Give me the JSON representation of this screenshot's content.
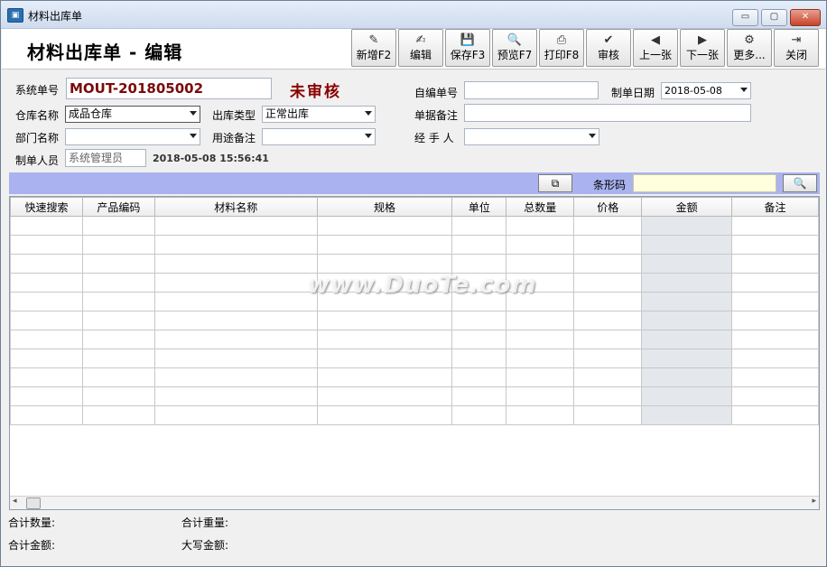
{
  "window": {
    "title": "材料出库单",
    "controls": {
      "minimize": "▭",
      "restore": "▢",
      "close": "✕"
    }
  },
  "header": {
    "title": "材料出库单 - 编辑"
  },
  "toolbar": [
    {
      "label": "新增F2",
      "icon": "new-icon",
      "glyph": "✎"
    },
    {
      "label": "编辑",
      "icon": "edit-icon",
      "glyph": "✍"
    },
    {
      "label": "保存F3",
      "icon": "save-icon",
      "glyph": "💾"
    },
    {
      "label": "预览F7",
      "icon": "preview-icon",
      "glyph": "🔍"
    },
    {
      "label": "打印F8",
      "icon": "print-icon",
      "glyph": "⎙"
    },
    {
      "label": "审核",
      "icon": "approve-icon",
      "glyph": "✔"
    },
    {
      "label": "上一张",
      "icon": "prev-icon",
      "glyph": "◀"
    },
    {
      "label": "下一张",
      "icon": "next-icon",
      "glyph": "▶"
    },
    {
      "label": "更多...",
      "icon": "more-icon",
      "glyph": "⚙"
    },
    {
      "label": "关闭",
      "icon": "exit-icon",
      "glyph": "⇥"
    }
  ],
  "form": {
    "system_no_label": "系统单号",
    "system_no_value": "MOUT-201805002",
    "status": "未审核",
    "self_no_label": "自编单号",
    "self_no_value": "",
    "date_label": "制单日期",
    "date_value": "2018-05-08",
    "warehouse_label": "仓库名称",
    "warehouse_value": "成品仓库",
    "outtype_label": "出库类型",
    "outtype_value": "正常出库",
    "note_label": "单据备注",
    "note_value": "",
    "dept_label": "部门名称",
    "dept_value": "",
    "purpose_label": "用途备注",
    "purpose_value": "",
    "handler_label": "经 手 人",
    "handler_value": "",
    "creator_label": "制单人员",
    "creator_value": "系统管理员",
    "created_time": "2018-05-08 15:56:41"
  },
  "barcode": {
    "label": "条形码",
    "value": ""
  },
  "table": {
    "columns": [
      "快速搜索",
      "产品编码",
      "材料名称",
      "规格",
      "单位",
      "总数量",
      "价格",
      "金额",
      "备注"
    ],
    "rows": [
      [
        "",
        "",
        "",
        "",
        "",
        "",
        "",
        "",
        ""
      ],
      [
        "",
        "",
        "",
        "",
        "",
        "",
        "",
        "",
        ""
      ],
      [
        "",
        "",
        "",
        "",
        "",
        "",
        "",
        "",
        ""
      ],
      [
        "",
        "",
        "",
        "",
        "",
        "",
        "",
        "",
        ""
      ],
      [
        "",
        "",
        "",
        "",
        "",
        "",
        "",
        "",
        ""
      ],
      [
        "",
        "",
        "",
        "",
        "",
        "",
        "",
        "",
        ""
      ],
      [
        "",
        "",
        "",
        "",
        "",
        "",
        "",
        "",
        ""
      ],
      [
        "",
        "",
        "",
        "",
        "",
        "",
        "",
        "",
        ""
      ],
      [
        "",
        "",
        "",
        "",
        "",
        "",
        "",
        "",
        ""
      ],
      [
        "",
        "",
        "",
        "",
        "",
        "",
        "",
        "",
        ""
      ],
      [
        "",
        "",
        "",
        "",
        "",
        "",
        "",
        "",
        ""
      ]
    ]
  },
  "summary": {
    "total_qty": "合计数量:",
    "total_weight": "合计重量:",
    "total_amount": "合计金额:",
    "amount_words": "大写金额:"
  },
  "watermark": "www.DuoTe.com"
}
